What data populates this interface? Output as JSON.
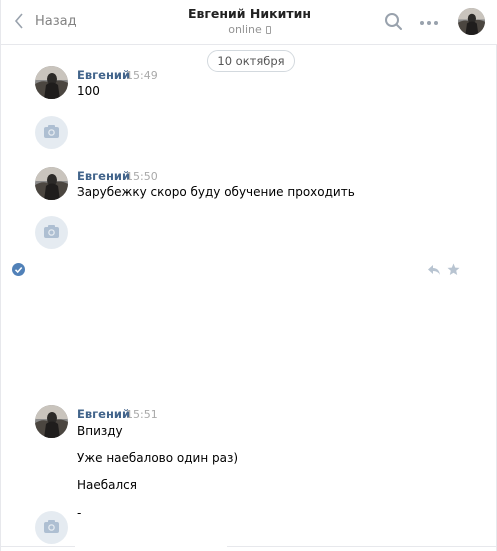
{
  "header": {
    "back_label": "Назад",
    "contact_name": "Евгений Никитин",
    "status": "online",
    "icons": [
      "chevron-left-icon",
      "search-icon",
      "more-icon"
    ]
  },
  "date_separator": "10 октября",
  "messages": [
    {
      "author": "Евгений",
      "time": "15:49",
      "lines": [
        "100"
      ]
    },
    {
      "author": "Евгений",
      "time": "15:50",
      "lines": [
        "Зарубежку скоро буду обучение проходить"
      ]
    },
    {
      "author": "Евгений",
      "time": "15:51",
      "lines": [
        "Впизду",
        "Уже наебалово один раз)",
        "Наебался",
        "-"
      ]
    }
  ],
  "colors": {
    "accent": "#42648b",
    "muted": "#a9a9a9",
    "border": "#e7e8ec",
    "check": "#5181b8"
  }
}
